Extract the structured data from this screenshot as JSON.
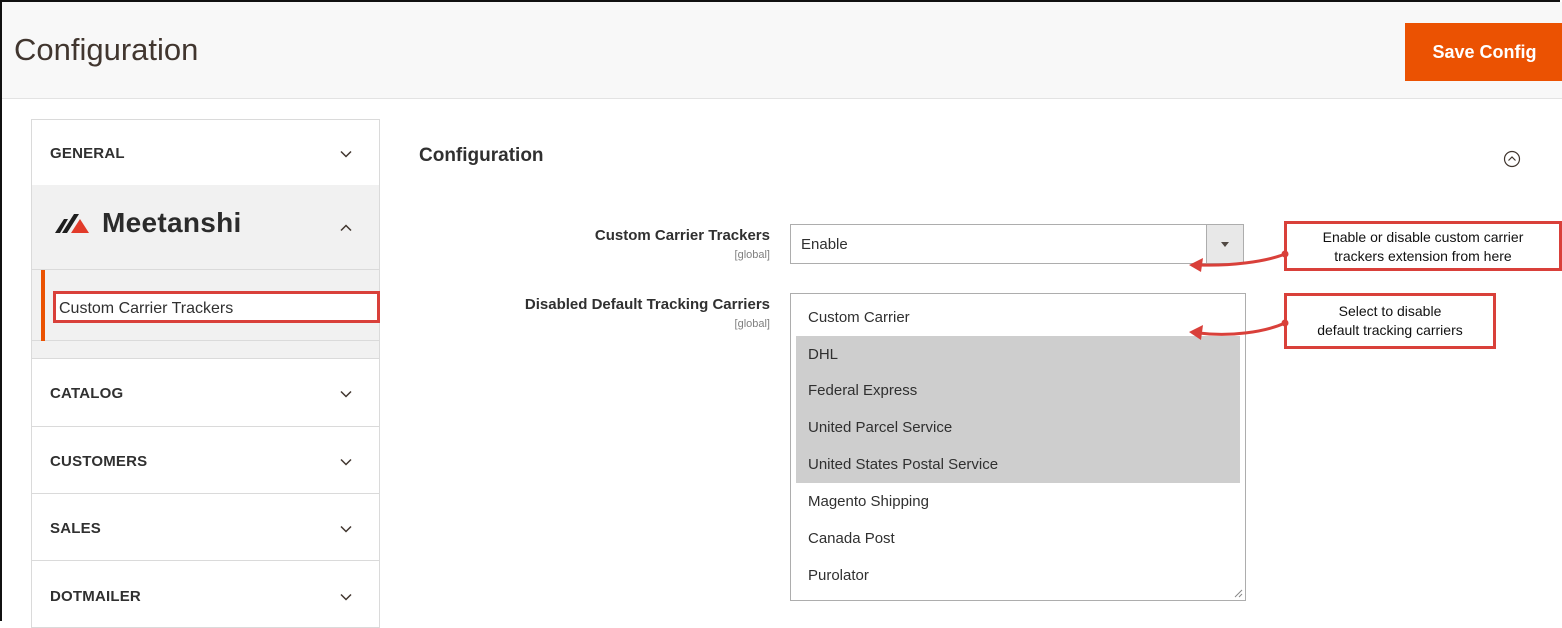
{
  "header": {
    "title": "Configuration",
    "save_label": "Save Config"
  },
  "sidebar": {
    "tabs": [
      {
        "label": "GENERAL"
      },
      {
        "label": "CATALOG"
      },
      {
        "label": "CUSTOMERS"
      },
      {
        "label": "SALES"
      },
      {
        "label": "DOTMAILER"
      }
    ],
    "brand": "Meetanshi",
    "active_item": "Custom Carrier Trackers"
  },
  "main": {
    "section_title": "Configuration",
    "fields": {
      "trackers_label": "Custom Carrier Trackers",
      "trackers_scope": "[global]",
      "trackers_value": "Enable",
      "disabled_label": "Disabled Default Tracking Carriers",
      "disabled_scope": "[global]"
    },
    "carriers": [
      {
        "label": "Custom Carrier",
        "selected": false
      },
      {
        "label": "DHL",
        "selected": true
      },
      {
        "label": "Federal Express",
        "selected": true
      },
      {
        "label": "United Parcel Service",
        "selected": true
      },
      {
        "label": "United States Postal Service",
        "selected": true
      },
      {
        "label": "Magento Shipping",
        "selected": false
      },
      {
        "label": "Canada Post",
        "selected": false
      },
      {
        "label": "Purolator",
        "selected": false
      }
    ]
  },
  "annotations": {
    "callout1_line1": "Enable or disable custom carrier",
    "callout1_line2": "trackers extension from here",
    "callout2_line1": "Select to disable",
    "callout2_line2": "default tracking carriers"
  },
  "colors": {
    "accent": "#eb5202",
    "highlight_border": "#d9403a",
    "selected_option": "#cecece"
  }
}
